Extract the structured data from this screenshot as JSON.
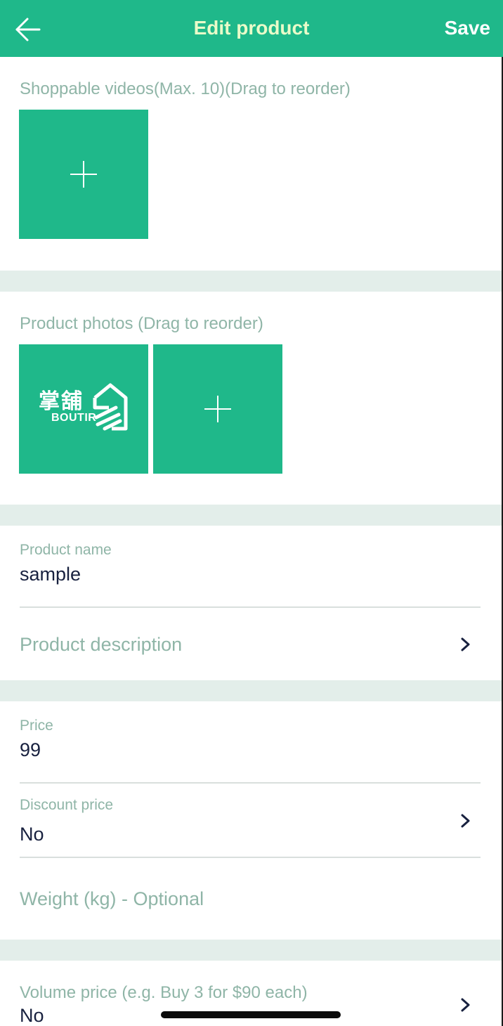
{
  "header": {
    "title": "Edit product",
    "save_label": "Save",
    "back_icon": "back-arrow-icon"
  },
  "videos": {
    "label": "Shoppable videos(Max. 10)(Drag to reorder)",
    "add_icon": "plus-icon"
  },
  "photos": {
    "label": "Product photos (Drag to reorder)",
    "items": [
      {
        "logo_cn": "掌舖",
        "logo_en": "BOUTIR"
      }
    ],
    "add_icon": "plus-icon"
  },
  "product": {
    "name_label": "Product name",
    "name_value": "sample",
    "description_label": "Product description"
  },
  "pricing": {
    "price_label": "Price",
    "price_value": "99",
    "discount_label": "Discount price",
    "discount_value": "No",
    "weight_placeholder": "Weight (kg) - Optional",
    "volume_label": "Volume price (e.g. Buy 3 for $90 each)",
    "volume_value": "No"
  },
  "colors": {
    "brand_green": "#1fb88a",
    "header_title": "#e9fbc9",
    "muted_label": "#8fb5a7",
    "value_text": "#18213f",
    "section_band": "#e3eeea"
  }
}
